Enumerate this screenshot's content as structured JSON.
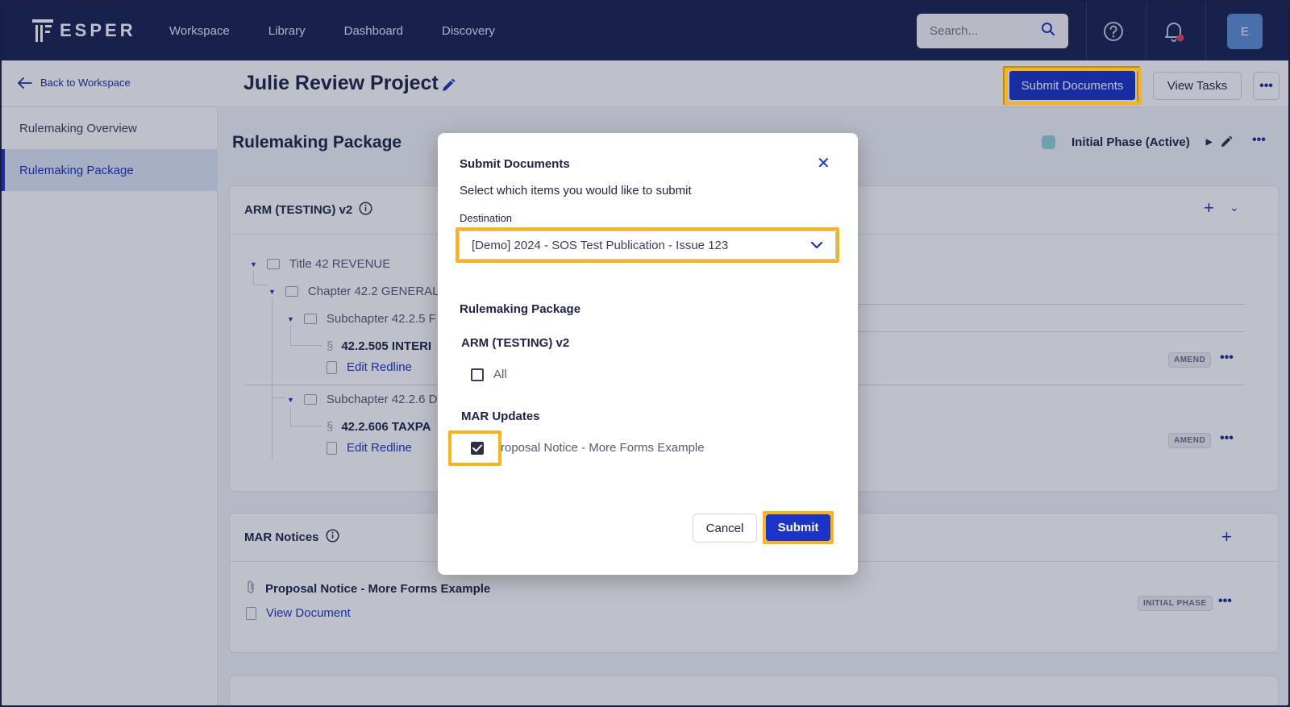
{
  "app": {
    "logo_text": "ESPER",
    "nav": [
      "Workspace",
      "Library",
      "Dashboard",
      "Discovery"
    ],
    "search_placeholder": "Search...",
    "avatar_initial": "E"
  },
  "header": {
    "back_label": "Back to Workspace",
    "project_title": "Julie Review Project",
    "submit_documents_label": "Submit Documents",
    "view_tasks_label": "View Tasks"
  },
  "sidebar": {
    "items": [
      {
        "label": "Rulemaking Overview",
        "active": false
      },
      {
        "label": "Rulemaking Package",
        "active": true
      }
    ]
  },
  "main": {
    "title": "Rulemaking Package",
    "phase_label": "Initial Phase (Active)",
    "arm_card": {
      "title": "ARM (TESTING) v2",
      "tree": {
        "title": "Title 42 REVENUE",
        "chapter": "Chapter 42.2 GENERAL",
        "subchapter_a": "Subchapter 42.2.5 F",
        "section_a": "42.2.505 INTERI",
        "subchapter_b": "Subchapter 42.2.6 D",
        "section_b": "42.2.606 TAXPA",
        "section_symbol": "§",
        "edit_link": "Edit Redline",
        "badge": "AMEND"
      }
    },
    "mar_card": {
      "title": "MAR Notices",
      "doc_title": "Proposal Notice - More Forms Example",
      "doc_link": "View Document",
      "badge": "INITIAL PHASE"
    }
  },
  "modal": {
    "title": "Submit Documents",
    "subtitle": "Select which items you would like to submit",
    "destination_label": "Destination",
    "destination_value": "[Demo] 2024 - SOS Test Publication - Issue 123",
    "package_heading": "Rulemaking Package",
    "group_arm": "ARM (TESTING) v2",
    "all_label": "All",
    "all_checked": false,
    "group_mar": "MAR Updates",
    "mar_item_label": "Proposal Notice - More Forms Example",
    "mar_item_checked": true,
    "cancel_label": "Cancel",
    "submit_label": "Submit"
  },
  "colors": {
    "nav_bg": "#172251",
    "primary": "#1a33c8",
    "highlight": "#f5b51b",
    "phase_dot": "#8dd3d8",
    "avatar_bg": "#5b8fd6"
  }
}
